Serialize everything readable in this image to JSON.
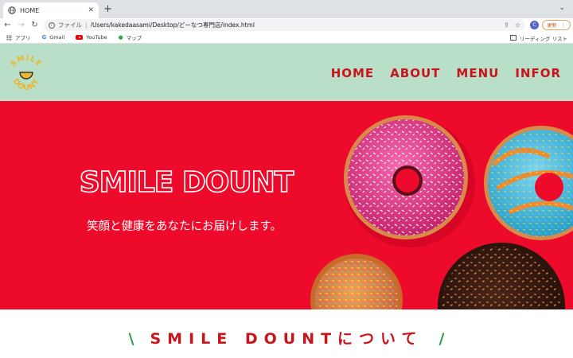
{
  "browser": {
    "tab_title": "HOME",
    "new_tab_symbol": "+",
    "omnibox": {
      "scheme_label": "ファイル",
      "url": "/Users/kakedaasami/Desktop/どーなつ専門店/index.html"
    },
    "profile_initial": "C",
    "update_label": "更新",
    "bookmarks": [
      {
        "label": "アプリ"
      },
      {
        "label": "Gmail"
      },
      {
        "label": "YouTube"
      },
      {
        "label": "マップ"
      }
    ],
    "reading_list_label": "リーディング リスト"
  },
  "site": {
    "logo_text": "SMILE DOUNT",
    "nav": [
      "HOME",
      "ABOUT",
      "MENU",
      "INFOR"
    ],
    "hero": {
      "title": "SMILE DOUNT",
      "subtitle": "笑顔と健康をあなたにお届けします。"
    },
    "about_heading": "SMILE DOUNTについて",
    "colors": {
      "header_bg": "#b9dfc8",
      "hero_bg": "#ee0a2a",
      "accent_red": "#c8141a",
      "accent_green": "#2f9a54",
      "logo_yellow": "#e8b830"
    }
  }
}
